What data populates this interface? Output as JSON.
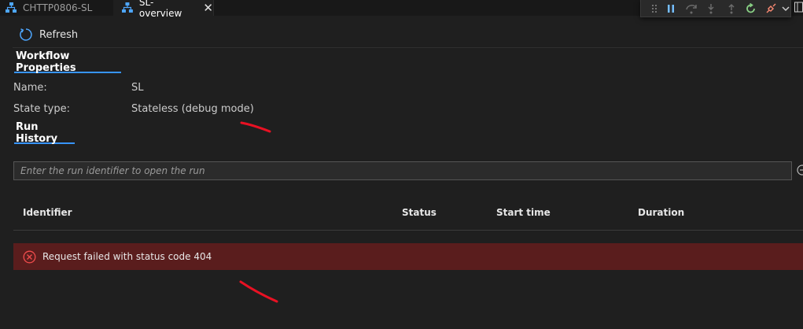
{
  "tabs": [
    {
      "label": "CHTTP0806-SL",
      "icon": "workflow-icon",
      "active": false
    },
    {
      "label": "SL-overview",
      "icon": "workflow-icon",
      "active": true
    }
  ],
  "toolbar": {
    "refresh_label": "Refresh"
  },
  "workflow_properties": {
    "title": "Workflow Properties",
    "name_label": "Name:",
    "name_value": "SL",
    "state_label": "State type:",
    "state_value": "Stateless (debug mode)"
  },
  "run_history": {
    "title": "Run History",
    "search_placeholder": "Enter the run identifier to open the run",
    "columns": [
      "Identifier",
      "Status",
      "Start time",
      "Duration"
    ],
    "error_message": "Request failed with status code 404"
  },
  "debug_toolbar": {
    "icons": [
      "gripper-icon",
      "pause-icon",
      "step-over-icon",
      "step-into-icon",
      "step-out-icon",
      "restart-icon",
      "disconnect-icon",
      "chevron-down-icon"
    ]
  },
  "colors": {
    "accent": "#3794ff",
    "error_bg": "#5a1d1d",
    "error_icon": "#f14c4c",
    "annotation": "#e81123",
    "restart": "#89d185",
    "disconnect": "#f48771"
  }
}
